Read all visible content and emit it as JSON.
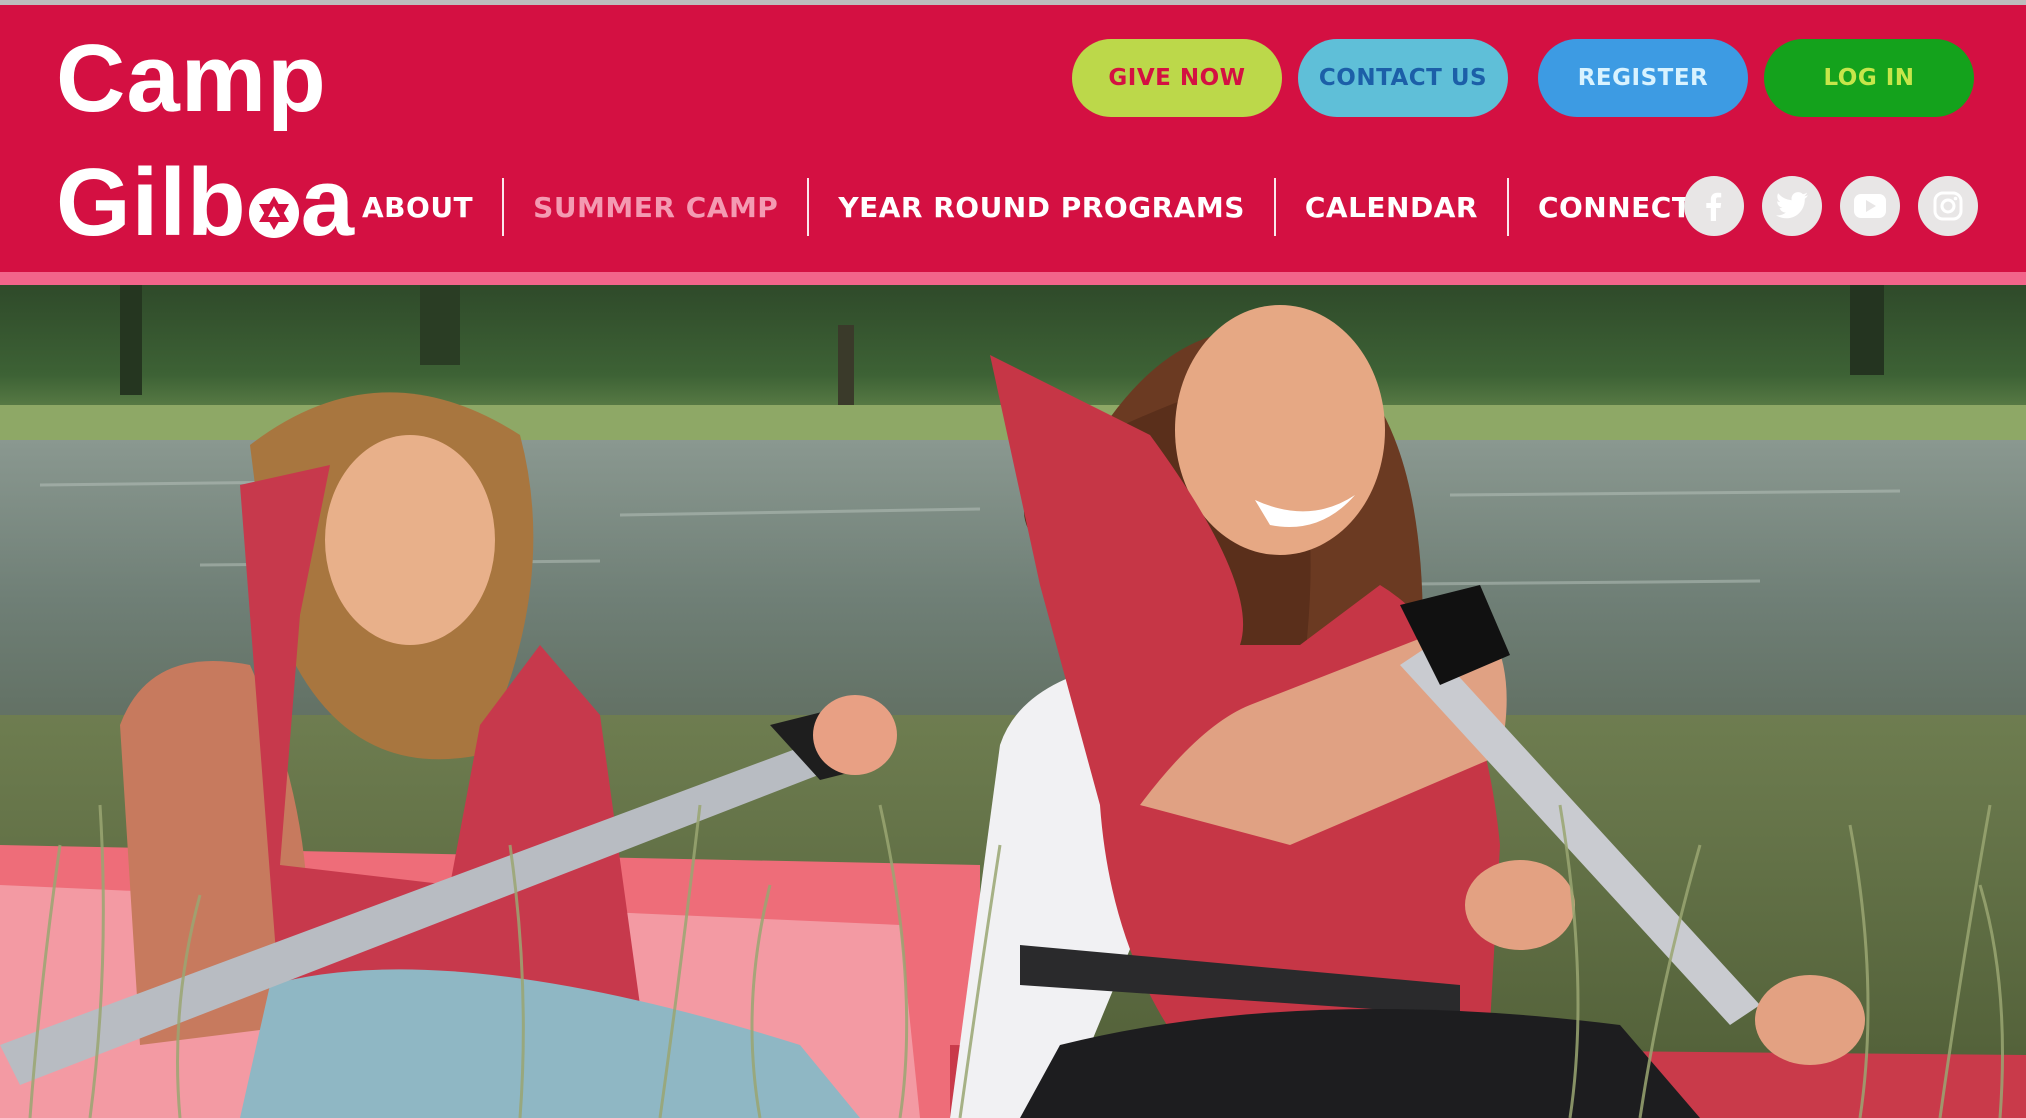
{
  "logo": {
    "line1": "Camp",
    "line2_start": "Gilb",
    "line2_end": "a"
  },
  "actions": {
    "give_now": "GIVE NOW",
    "contact_us": "CONTACT US",
    "register": "REGISTER",
    "log_in": "LOG IN"
  },
  "nav": {
    "items": [
      {
        "label": "ABOUT",
        "active": false
      },
      {
        "label": "SUMMER CAMP",
        "active": true
      },
      {
        "label": "YEAR ROUND PROGRAMS",
        "active": false
      },
      {
        "label": "CALENDAR",
        "active": false
      },
      {
        "label": "CONNECT",
        "active": false
      }
    ]
  },
  "social": [
    "facebook-icon",
    "twitter-icon",
    "youtube-icon",
    "instagram-icon"
  ],
  "colors": {
    "header": "#d41042",
    "header_stripe": "#f2648a",
    "active_nav": "#f49ab2",
    "give_now": "#bcd84a",
    "contact_us": "#5fbfd8",
    "register": "#3d9be3",
    "log_in": "#14a21c"
  }
}
